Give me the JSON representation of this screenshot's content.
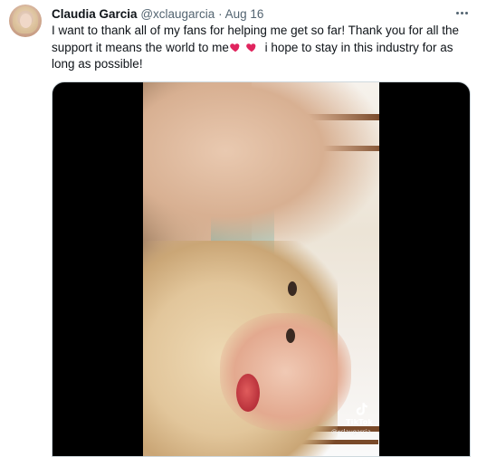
{
  "tweet": {
    "author_name": "Claudia Garcia",
    "author_handle": "@xclaugarcia",
    "separator": "·",
    "date": "Aug 16",
    "text_before_emoji": "I want to thank all of my fans for helping me get so far! Thank you for all the support it means the world to me",
    "emoji": "💕💕",
    "text_after_emoji": " i hope to stay in this industry for as long as possible!"
  },
  "media": {
    "watermark_brand": "TikTok",
    "watermark_handle": "@xclaugarcia"
  },
  "icons": {
    "more": "more-horizontal-icon",
    "tiktok": "tiktok-logo-icon",
    "hearts": "two-hearts-emoji"
  },
  "colors": {
    "text_primary": "#0f1419",
    "text_secondary": "#536471",
    "border": "#cfd9de",
    "heart": "#e0245e"
  }
}
